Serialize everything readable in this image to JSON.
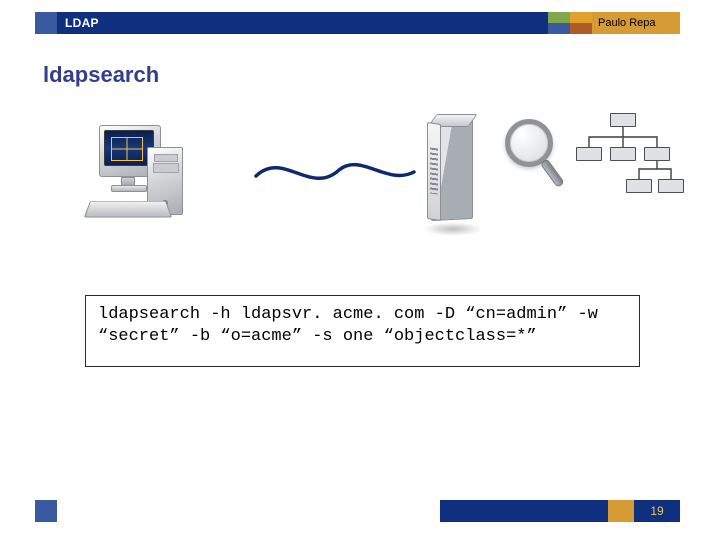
{
  "header": {
    "topic": "LDAP",
    "author": "Paulo Repa"
  },
  "title": "ldapsearch",
  "command": "ldapsearch -h ldapsvr. acme. com -D “cn=admin” -w “secret” -b “o=acme” -s one “objectclass=*”",
  "footer": {
    "page": "19"
  },
  "icons": {
    "client": "desktop-computer",
    "server": "server-tower",
    "search": "magnifying-glass",
    "directory": "org-tree"
  }
}
